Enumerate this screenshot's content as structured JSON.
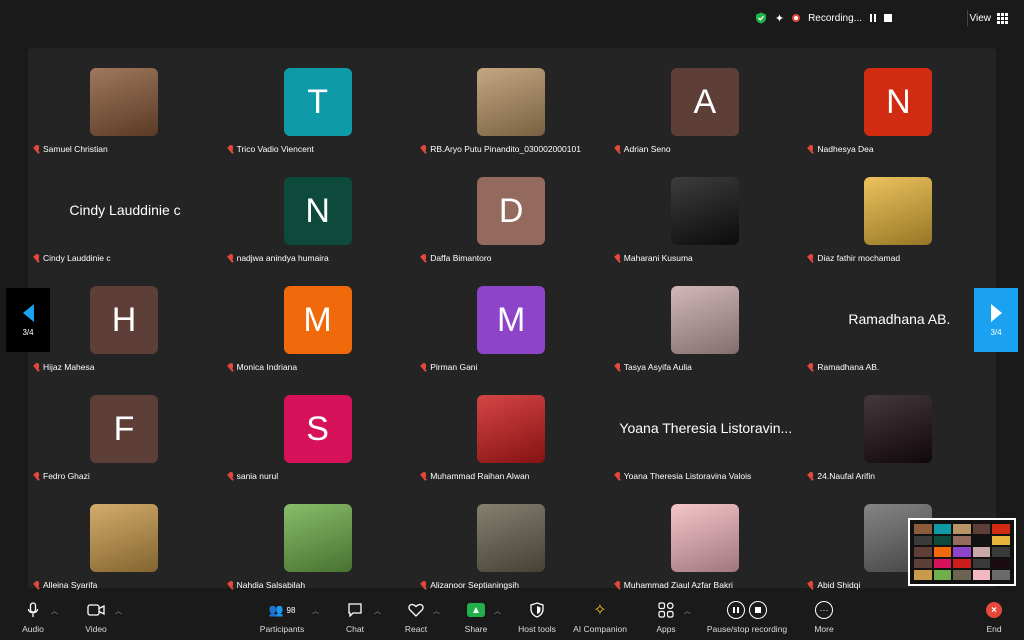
{
  "status": {
    "recording_label": "Recording...",
    "view_label": "View"
  },
  "pagination": {
    "left": "3/4",
    "right": "3/4"
  },
  "participants_grid": [
    {
      "name": "Samuel Christian",
      "avatar": {
        "type": "photo",
        "color": "#8a5a3a"
      }
    },
    {
      "name": "Trico Vadio Viencent",
      "avatar": {
        "type": "letter",
        "letter": "T",
        "color": "#0f9aa8"
      }
    },
    {
      "name": "RB.Aryo Putu Pinandito_030002000101",
      "avatar": {
        "type": "photo",
        "color": "#b89466"
      }
    },
    {
      "name": "Adrian Seno",
      "avatar": {
        "type": "letter",
        "letter": "A",
        "color": "#5e3f38"
      }
    },
    {
      "name": "Nadhesya Dea",
      "avatar": {
        "type": "letter",
        "letter": "N",
        "color": "#d12c12"
      }
    },
    {
      "name": "Cindy Lauddinie c",
      "avatar": {
        "type": "text",
        "text": "Cindy Lauddinie c"
      }
    },
    {
      "name": "nadjwa anindya humaira",
      "avatar": {
        "type": "letter",
        "letter": "N",
        "color": "#0d4a3c"
      }
    },
    {
      "name": "Daffa Bimantoro",
      "avatar": {
        "type": "letter",
        "letter": "D",
        "color": "#94695e"
      }
    },
    {
      "name": "Maharani Kusuma",
      "avatar": {
        "type": "photo",
        "color": "#121212"
      }
    },
    {
      "name": "Diaz fathir mochamad",
      "avatar": {
        "type": "photo",
        "color": "#e8b53a"
      }
    },
    {
      "name": "Hijaz Mahesa",
      "avatar": {
        "type": "letter",
        "letter": "H",
        "color": "#5e3f38"
      }
    },
    {
      "name": "Monica Indriana",
      "avatar": {
        "type": "letter",
        "letter": "M",
        "color": "#f06a0c"
      }
    },
    {
      "name": "Pirman Gani",
      "avatar": {
        "type": "letter",
        "letter": "M",
        "color": "#8d44c9"
      }
    },
    {
      "name": "Tasya Asyifa Aulia",
      "avatar": {
        "type": "photo",
        "color": "#c9a8a8"
      }
    },
    {
      "name": "Ramadhana AB.",
      "avatar": {
        "type": "text",
        "text": "Ramadhana AB."
      }
    },
    {
      "name": "Fedro Ghazi",
      "avatar": {
        "type": "letter",
        "letter": "F",
        "color": "#5e3f38"
      }
    },
    {
      "name": "sania nurul",
      "avatar": {
        "type": "letter",
        "letter": "S",
        "color": "#d6125a"
      }
    },
    {
      "name": "Muhammad Raihan Alwan",
      "avatar": {
        "type": "photo",
        "color": "#cc1c1c"
      }
    },
    {
      "name": "Yoana Theresia Listoravina Valois",
      "avatar": {
        "type": "text",
        "text": "Yoana Theresia Listoravin..."
      }
    },
    {
      "name": "24.Naufal Arifin",
      "avatar": {
        "type": "photo",
        "color": "#1a0c10"
      }
    },
    {
      "name": "Alleina Syarifa",
      "avatar": {
        "type": "photo",
        "color": "#c99a4a"
      }
    },
    {
      "name": "Nahdia Salsabilah",
      "avatar": {
        "type": "photo",
        "color": "#6fae4a"
      }
    },
    {
      "name": "Alizanoor Septianingsih",
      "avatar": {
        "type": "photo",
        "color": "#6a6450"
      }
    },
    {
      "name": "Muhammad Ziaul Azfar Bakri",
      "avatar": {
        "type": "photo",
        "color": "#f3b8c0"
      }
    },
    {
      "name": "Abid Shidqi",
      "avatar": {
        "type": "photo",
        "color": "#6a6a6a"
      }
    }
  ],
  "toolbar": {
    "audio": "Audio",
    "video": "Video",
    "participants": "Participants",
    "participants_count": "98",
    "chat": "Chat",
    "react": "React",
    "share": "Share",
    "host_tools": "Host tools",
    "ai_companion": "AI Companion",
    "apps": "Apps",
    "recording": "Pause/stop recording",
    "more": "More",
    "end": "End"
  },
  "colors": {
    "background": "#1a1a1a",
    "gallery": "#242424",
    "accent_blue": "#1aa2f0",
    "muted_red": "#e5483b",
    "share_green": "#21b04a"
  }
}
